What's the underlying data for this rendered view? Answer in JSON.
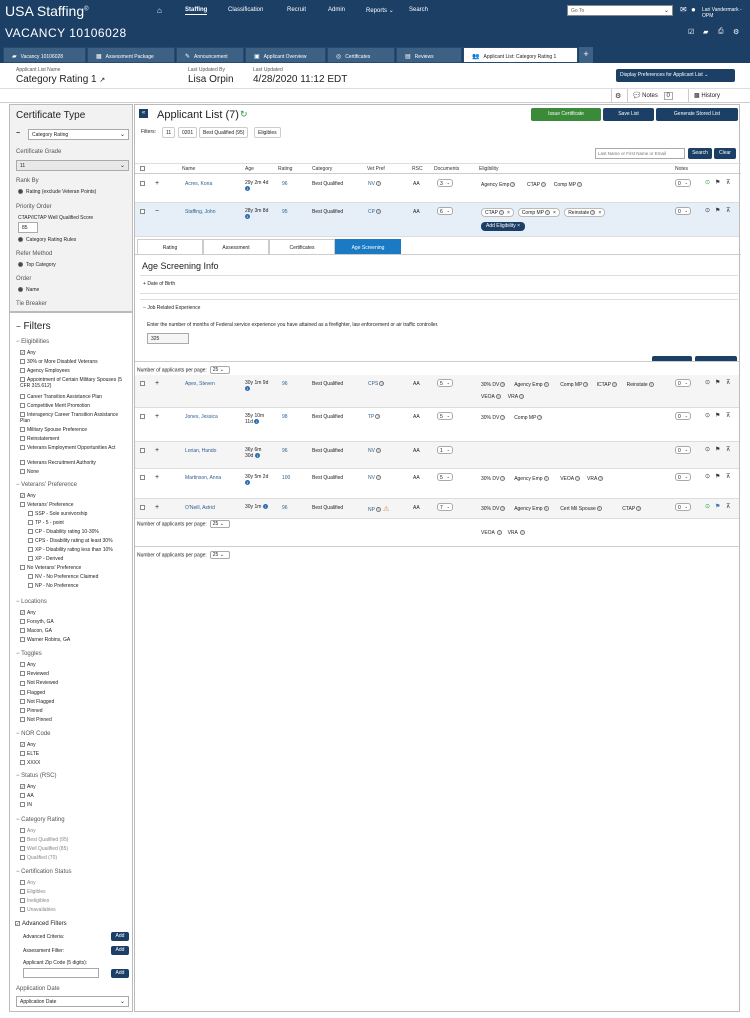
{
  "topnav": {
    "logo": "USA Staffing",
    "items": [
      "Staffing",
      "Classification",
      "Recruit",
      "Admin",
      "Reports",
      "Search"
    ],
    "goto_placeholder": "Go To",
    "user": "Lari Vandermark - OPM"
  },
  "vacancy": {
    "title": "VACANCY 10106028"
  },
  "tabs": [
    "Vacancy 10106028",
    "Assessment Package",
    "Announcement",
    "Applicant Overview",
    "Certificates",
    "Reviews",
    "Applicant List: Category Rating 1"
  ],
  "header": {
    "list_name_label": "Applicant List Name",
    "list_name": "Category Rating 1",
    "updated_by_label": "Last Updated By",
    "updated_by": "Lisa Orpin",
    "updated_label": "Last Updated",
    "updated": "4/28/2020 11:12 EDT",
    "display_prefs": "Display Preferences for Applicant List"
  },
  "toolbar2": {
    "notes": "Notes",
    "notes_count": "0",
    "history": "History"
  },
  "sidebar": {
    "cert_type_title": "Certificate Type",
    "cert_type": "Category Rating",
    "cert_grade_label": "Certificate Grade",
    "cert_grade": "11",
    "rank_by_label": "Rank By",
    "rank_by": "Rating (exclude Veteran Points)",
    "priority_label": "Priority Order",
    "ctap_label": "CTAP/ICTAP Well Qualified Score",
    "ctap_value": "85",
    "priority": "Category Rating Rules",
    "refer_label": "Refer Method",
    "refer": "Top Category",
    "order_label": "Order",
    "order": "Name",
    "tie_label": "Tie Breaker",
    "filters_title": "Filters",
    "eligibilities_label": "Eligibilities",
    "eligibilities": [
      "Any",
      "30% or More Disabled Veterans",
      "Agency Employees",
      "Appointment of Certain Military Spouses (5 CFR 315.612)",
      "Career Transition Assistance Plan",
      "Competitive Merit Promotion",
      "Interagency Career Transition Assistance Plan",
      "Military Spouse Preference",
      "Reinstatement",
      "Veterans Employment Opportunities Act",
      "Veterans Recruitment Authority",
      "None"
    ],
    "vets_label": "Veterans' Preference",
    "vets": [
      "Any",
      "Veterans' Preference",
      "SSP - Sole survivorship",
      "TP - 5 - point",
      "CP - Disability rating 10-30%",
      "CPS - Disability rating at least 30%",
      "XP - Disability rating less than 10%",
      "XP - Derived",
      "No Veterans' Preference",
      "NV - No Preference Claimed",
      "NP - No Preference"
    ],
    "locations_label": "Locations",
    "locations": [
      "Any",
      "Forsyth, GA",
      "Macon, GA",
      "Warner Robins, GA"
    ],
    "toggles_label": "Toggles",
    "toggles": [
      "Any",
      "Reviewed",
      "Not Reviewed",
      "Flagged",
      "Not Flagged",
      "Pinned",
      "Not Pinned"
    ],
    "nor_label": "NOR Code",
    "nor": [
      "Any",
      "ELTE",
      "XXXX"
    ],
    "status_label": "Status (RSC)",
    "status": [
      "Any",
      "AA",
      "IN"
    ],
    "catrating_label": "Category Rating",
    "catrating": [
      "Any",
      "Best Qualified (95)",
      "Well Qualified (85)",
      "Qualified (70)"
    ],
    "certstatus_label": "Certification Status",
    "certstatus": [
      "Any",
      "Eligibles",
      "Ineligibles",
      "Unavailables"
    ],
    "advanced_label": "Advanced Filters",
    "adv_criteria": "Advanced Criteria:",
    "adv_assessment": "Assessment Filter:",
    "adv_zip": "Applicant Zip Code (5 digits):",
    "add": "Add",
    "appdate_label": "Application Date",
    "appdate": "Application Date"
  },
  "main": {
    "title": "Applicant List (7)",
    "issue": "Issue Certificate",
    "save": "Save List",
    "generate": "Generate Stored List",
    "filters_label": "Filters:",
    "filter_chips": [
      "11",
      "0201",
      "Best Qualified (95)",
      "Eligibles"
    ],
    "search_placeholder": "Last Name or First Name or Email",
    "search": "Search",
    "clear": "Clear",
    "columns": [
      "Name",
      "Age",
      "Rating",
      "Category",
      "Vet Pref",
      "RSC",
      "Documents",
      "Eligibility",
      "Notes"
    ],
    "rows": [
      {
        "name": "Acres, Kona",
        "age": "29y 2m 4d",
        "rating": "96",
        "category": "Best Qualified",
        "vet": "NV",
        "rsc": "AA",
        "docs": "3",
        "elig": [
          "Agency Emp",
          "CTAP",
          "Comp MP"
        ],
        "notes": "0"
      },
      {
        "name": "Staffing, John",
        "age": "28y 3m 8d",
        "rating": "95",
        "category": "Best Qualified",
        "vet": "CP",
        "rsc": "AA",
        "docs": "6",
        "elig": [
          "CTAP",
          "Comp MP",
          "Reinstate"
        ],
        "notes": "0",
        "add_elig": "Add Eligibility"
      }
    ],
    "detail_tabs": [
      "Rating",
      "Assessment",
      "Certificates",
      "Age Screening"
    ],
    "age_title": "Age Screening Info",
    "dob": "Date of Birth",
    "jre": "Job Related Experience",
    "jre_text": "Enter the number of months of Federal service experience you have attained as a firefighter, law enforcement or air traffic controller.",
    "jre_value": "325",
    "per_page_label": "Number of applicants per page:",
    "per_page": "25",
    "rows2": [
      {
        "name": "Apex, Steven",
        "age": "30y 1m 9d",
        "rating": "96",
        "category": "Best Qualified",
        "vet": "CPS",
        "rsc": "AA",
        "docs": "5",
        "elig": [
          "30% DV",
          "Agency Emp",
          "Comp MP",
          "ICTAP",
          "Reinstate",
          "VEOA",
          "VRA"
        ],
        "notes": "0"
      },
      {
        "name": "Jones, Jessica",
        "age": "35y 10m 11d",
        "rating": "98",
        "category": "Best Qualified",
        "vet": "TP",
        "rsc": "AA",
        "docs": "5",
        "elig": [
          "30% DV",
          "Comp MP"
        ],
        "notes": "0"
      },
      {
        "name": "Lorian, Hando",
        "age": "36y 6m 30d",
        "rating": "96",
        "category": "Best Qualified",
        "vet": "NV",
        "rsc": "AA",
        "docs": "1",
        "elig": [],
        "notes": "0"
      },
      {
        "name": "Martinson, Anna",
        "age": "30y 5m 2d",
        "rating": "100",
        "category": "Best Qualified",
        "vet": "NV",
        "rsc": "AA",
        "docs": "5",
        "elig": [
          "30% DV",
          "Agency Emp",
          "VEOA",
          "VRA"
        ],
        "notes": "0"
      },
      {
        "name": "O'Neill, Astrid",
        "age": "30y 1m",
        "rating": "96",
        "category": "Best Qualified",
        "vet": "NP",
        "rsc": "AA",
        "docs": "7",
        "elig": [
          "30% DV",
          "Agency Emp",
          "Cert Mil Spouse",
          "CTAP"
        ],
        "notes": "0"
      }
    ],
    "overflow_elig": [
      "VEOA",
      "VRA"
    ]
  },
  "colors": {
    "navy": "#1c3f66",
    "green": "#3a8a3a",
    "blue": "#1a7bc4"
  }
}
